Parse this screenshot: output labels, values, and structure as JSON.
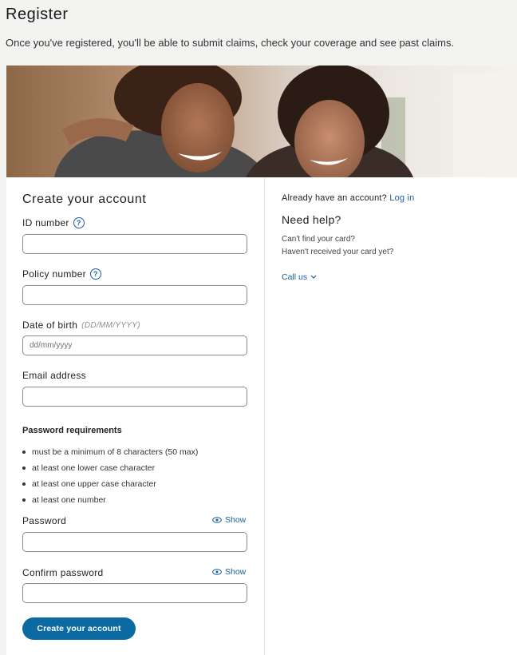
{
  "page": {
    "title": "Register",
    "subtitle": "Once you've registered, you'll be able to submit claims, check your coverage and see past claims."
  },
  "form": {
    "title": "Create your account",
    "id_label": "ID number",
    "policy_label": "Policy number",
    "dob_label": "Date of birth",
    "dob_hint": "(DD/MM/YYYY)",
    "dob_placeholder": "dd/mm/yyyy",
    "email_label": "Email address",
    "password_requirements_title": "Password requirements",
    "password_requirements": [
      "must be a minimum of 8 characters (50 max)",
      "at least one lower case character",
      "at least one upper case character",
      "at least one number"
    ],
    "password_label": "Password",
    "confirm_label": "Confirm password",
    "show_label": "Show",
    "submit_label": "Create your account"
  },
  "sidebar": {
    "already_text": "Already have an account?",
    "login_link": "Log in",
    "need_help_title": "Need help?",
    "help_line1": "Can't find your card?",
    "help_line2": "Haven't received your card yet?",
    "call_us": "Call us"
  },
  "colors": {
    "accent": "#0a6aa1",
    "link": "#1b5fa0",
    "background": "#f3f3f2"
  }
}
